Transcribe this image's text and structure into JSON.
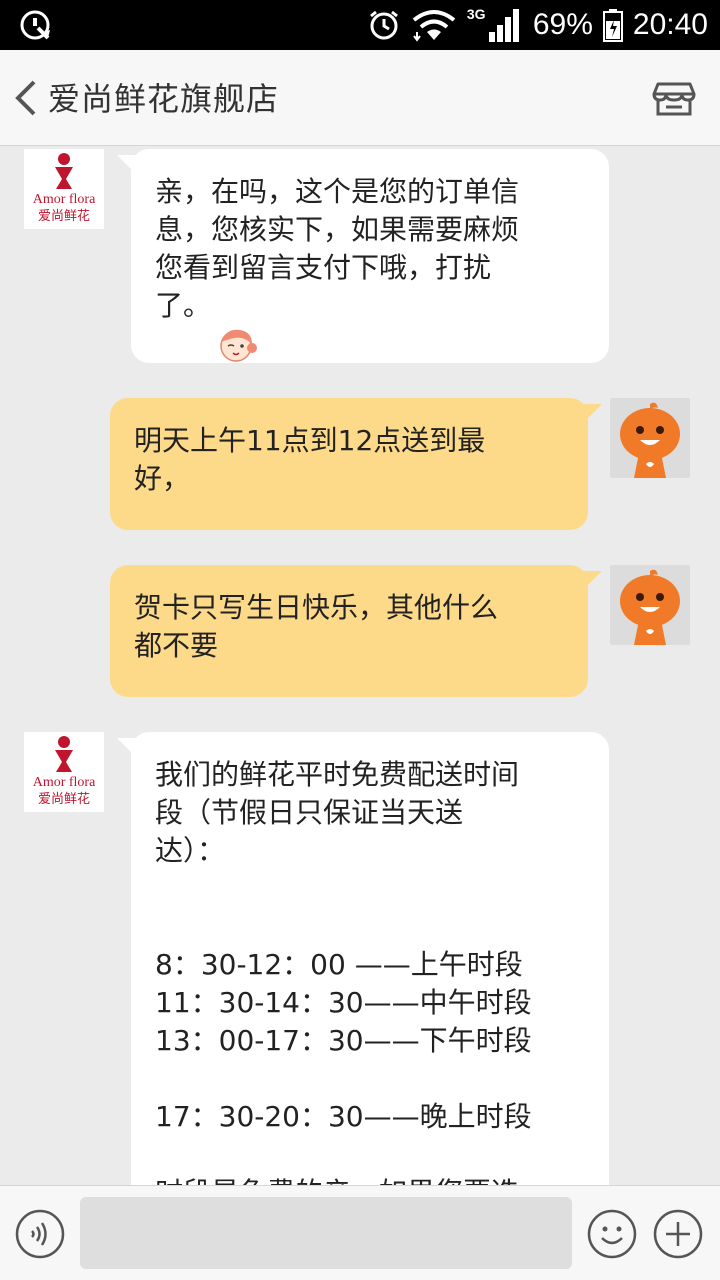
{
  "status_bar": {
    "network": "3G",
    "battery": "69%",
    "time": "20:40"
  },
  "header": {
    "title": "爱尚鲜花旗舰店"
  },
  "shop_avatar": {
    "logo_text": "Amor flora",
    "logo_subtext": "爱尚鲜花"
  },
  "messages": [
    {
      "side": "in",
      "lines": [
        "亲，在吗，这个是您的订单信",
        "息，您核实下，如果需要麻烦",
        "您看到留言支付下哦，打扰",
        "了。"
      ],
      "emoji": "cartoon-girl-emoji"
    },
    {
      "side": "out",
      "lines": [
        "明天上午11点到12点送到最",
        "好，"
      ]
    },
    {
      "side": "out",
      "lines": [
        "贺卡只写生日快乐，其他什么",
        "都不要"
      ]
    },
    {
      "side": "in",
      "lines": [
        "我们的鲜花平时免费配送时间",
        "段（节假日只保证当天送",
        "达）：",
        "",
        "",
        "8：30-12：00 ——上午时段",
        "11：30-14：30——中午时段",
        "13：00-17：30——下午时段",
        "",
        "17：30-20：30——晚上时段",
        "",
        "时段是免费的亲，如果您要选"
      ]
    }
  ],
  "colors": {
    "outgoing_bubble": "#fdd98a",
    "incoming_bubble": "#ffffff",
    "chat_bg": "#ebebeb",
    "logo_red": "#c0152f",
    "user_avatar_orange": "#f07a28"
  }
}
